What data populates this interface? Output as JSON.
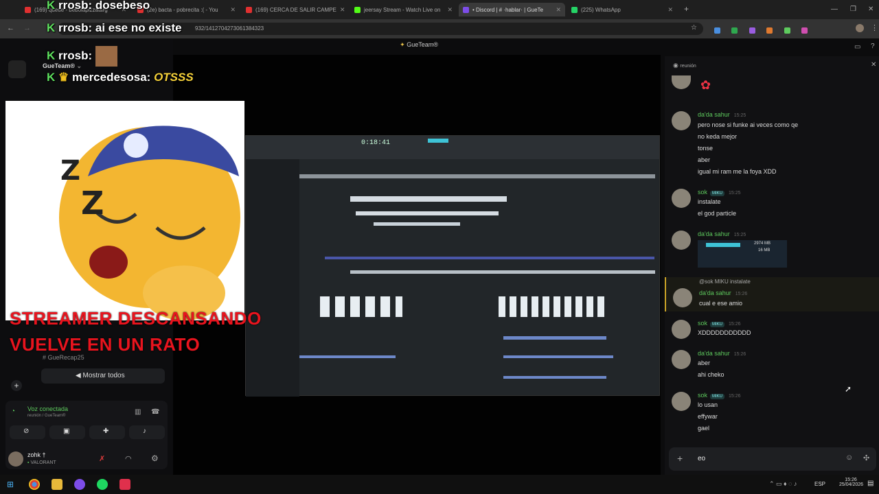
{
  "browser": {
    "tabs": [
      {
        "label": "(169) queue - bebolapizzatarg",
        "icon": "youtube-icon",
        "color": "#e03030",
        "active": false
      },
      {
        "label": "(2e) bacta - pobrecita :( - You",
        "icon": "youtube-icon",
        "color": "#e03030",
        "active": false
      },
      {
        "label": "(169) CERCA DE SALIR CAMPE",
        "icon": "youtube-icon",
        "color": "#e03030",
        "active": false
      },
      {
        "label": "jeersay Stream - Watch Live on",
        "icon": "kick-icon",
        "color": "#53fc18",
        "active": false
      },
      {
        "label": "• Discord | # ·hablar· | GueTe",
        "icon": "discord-icon",
        "color": "#7d4de8",
        "active": true
      },
      {
        "label": "(225) WhatsApp",
        "icon": "whatsapp-icon",
        "color": "#25d366",
        "active": false
      }
    ],
    "url_text": "932/1412704273061384323"
  },
  "overlay": {
    "kick_marker": "K",
    "lines": [
      {
        "user": "rrosb:",
        "text": "dosebeso"
      },
      {
        "user": "rrosb:",
        "text": "ai ese no existe"
      },
      {
        "user": "rrosb:",
        "text": ""
      },
      {
        "user": "mercedesosa:",
        "text": "OTSSS"
      }
    ],
    "banner_line1": "STREAMER DESCANSANDO",
    "banner_line2": "VUELVE EN UN RATO"
  },
  "discord": {
    "server_name": "GueTeam®",
    "window_title": "GueTeam®",
    "channel_hint": "GueRecap25",
    "show_all_label": "Mostrar todos",
    "voice_status": "Voz conectada",
    "voice_sub": "reunión / GueTeam®",
    "user": {
      "name": "zohk †",
      "activity": "VALORANT"
    },
    "chat_header": "reunión",
    "share_timer": "0:18:41",
    "input_value": "eo",
    "messages": [
      {
        "user": "da'da sahur",
        "time": "15:25",
        "lines": [
          "pero nose si funke ai veces como qe",
          "no keda mejor",
          "tonse",
          "aber",
          "igual mi ram me la foya XDD"
        ]
      },
      {
        "user": "sok",
        "tag": "MIKU",
        "time": "15:25",
        "lines": [
          "instalate",
          "el god particle"
        ]
      },
      {
        "user": "da'da sahur",
        "time": "15:25",
        "lines": [
          "2974 MB",
          "16 MB"
        ]
      },
      {
        "user": "da'da sahur",
        "time": "15:26",
        "reply": "@sok  MIKU  instalate",
        "lines": [
          "cual e ese amio"
        ]
      },
      {
        "user": "sok",
        "tag": "MIKU",
        "time": "15:26",
        "lines": [
          "XDDDDDDDDDDD"
        ]
      },
      {
        "user": "da'da sahur",
        "time": "15:26",
        "lines": [
          "aber",
          "ahi cheko"
        ]
      },
      {
        "user": "sok",
        "tag": "MIKU",
        "time": "15:26",
        "lines": [
          "lo usan",
          "effywar",
          "gael"
        ]
      }
    ]
  },
  "taskbar": {
    "lang": "ESP",
    "time": "15:26",
    "date": "25/04/2026"
  }
}
